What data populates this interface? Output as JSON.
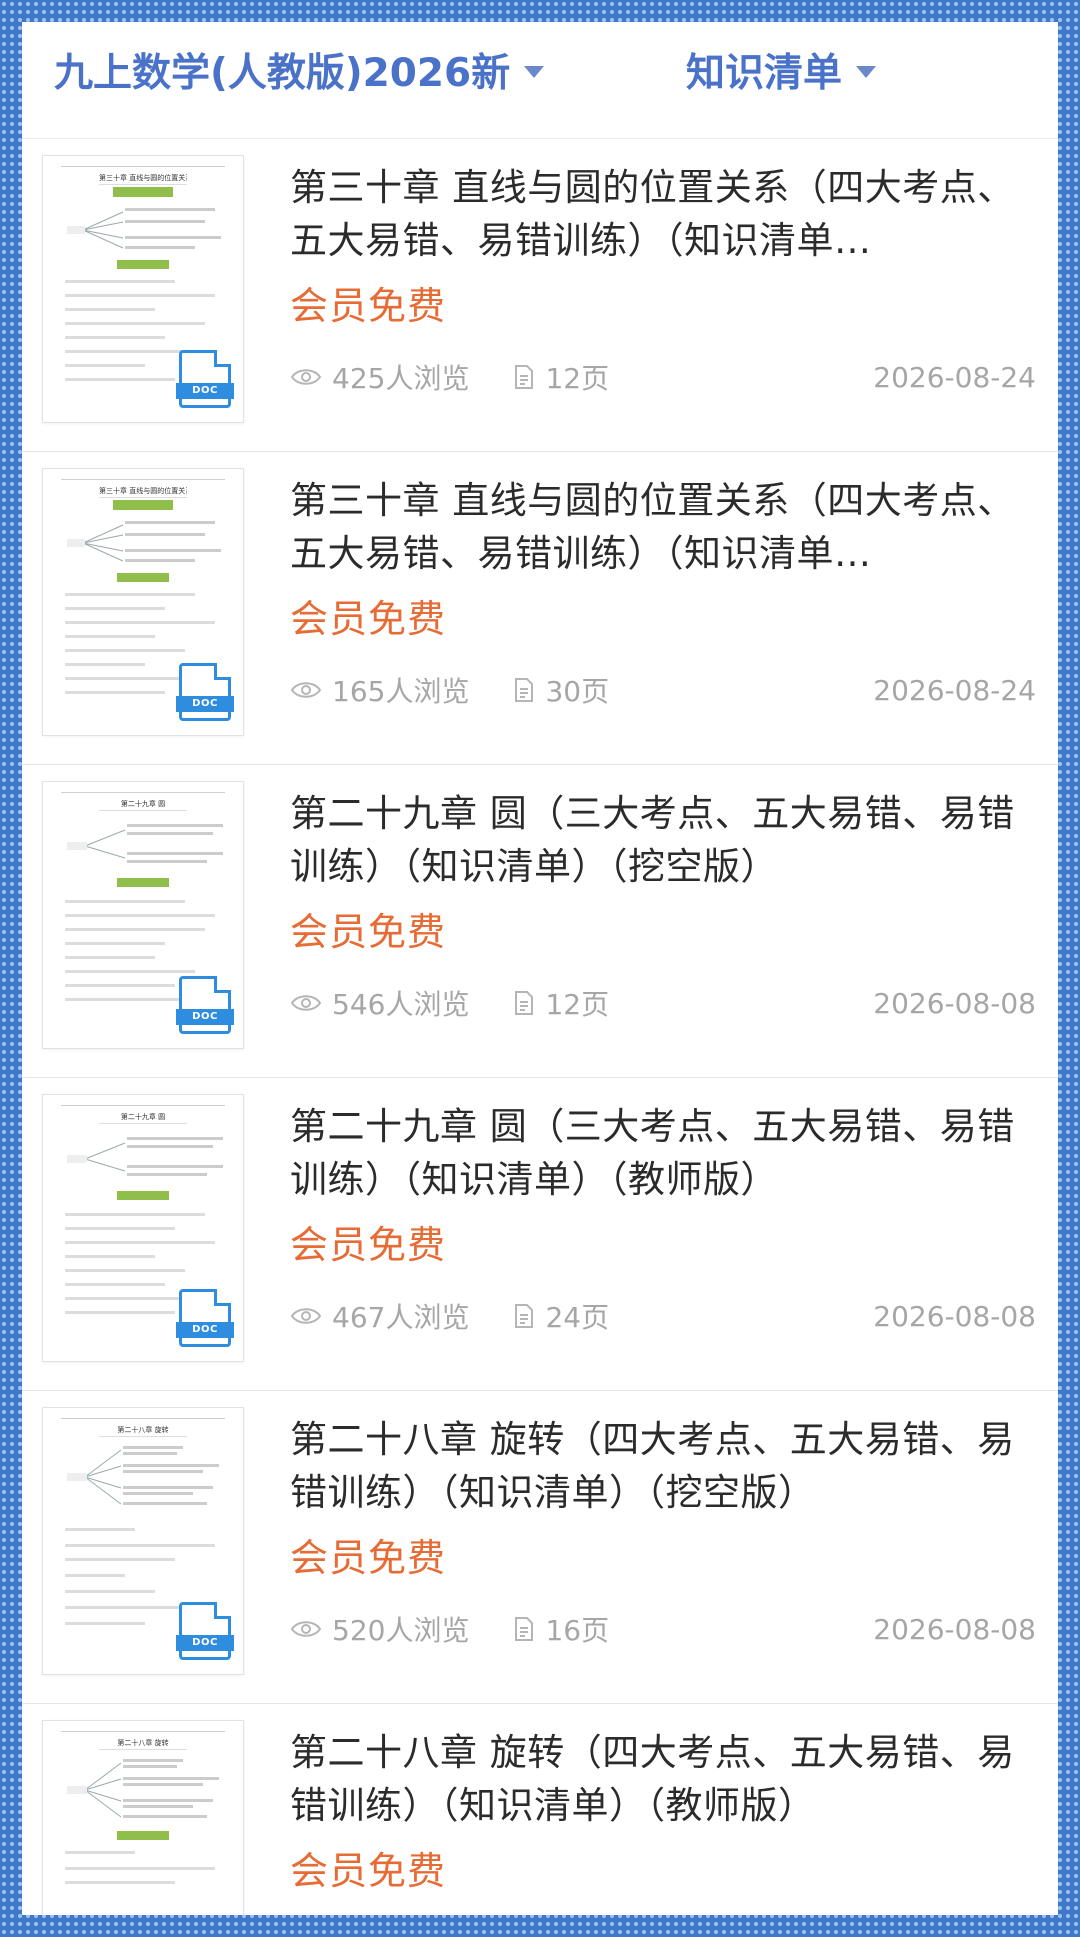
{
  "header": {
    "subject_label": "九上数学(人教版)2026新",
    "category_label": "知识清单"
  },
  "items": [
    {
      "title": "第三十章 直线与圆的位置关系（四大考点、五大易错、易错训练）（知识清单…",
      "price": "会员免费",
      "views": "425人浏览",
      "pages": "12页",
      "date": "2026-08-24",
      "thumb_chapter": "第三十章  直线与圆的位置关系",
      "doc_badge": "DOC"
    },
    {
      "title": "第三十章 直线与圆的位置关系（四大考点、五大易错、易错训练）（知识清单…",
      "price": "会员免费",
      "views": "165人浏览",
      "pages": "30页",
      "date": "2026-08-24",
      "thumb_chapter": "第三十章  直线与圆的位置关系",
      "doc_badge": "DOC"
    },
    {
      "title": "第二十九章 圆（三大考点、五大易错、易错训练）（知识清单）（挖空版）",
      "price": "会员免费",
      "views": "546人浏览",
      "pages": "12页",
      "date": "2026-08-08",
      "thumb_chapter": "第二十九章  圆",
      "doc_badge": "DOC"
    },
    {
      "title": "第二十九章 圆（三大考点、五大易错、易错训练）（知识清单）（教师版）",
      "price": "会员免费",
      "views": "467人浏览",
      "pages": "24页",
      "date": "2026-08-08",
      "thumb_chapter": "第二十九章  圆",
      "doc_badge": "DOC"
    },
    {
      "title": "第二十八章 旋转（四大考点、五大易错、易错训练）（知识清单）（挖空版）",
      "price": "会员免费",
      "views": "520人浏览",
      "pages": "16页",
      "date": "2026-08-08",
      "thumb_chapter": "第二十八章  旋转",
      "doc_badge": "DOC"
    },
    {
      "title": "第二十八章 旋转（四大考点、五大易错、易错训练）（知识清单）（教师版）",
      "price": "会员免费",
      "views": "",
      "pages": "",
      "date": "",
      "thumb_chapter": "第二十八章  旋转",
      "doc_badge": ""
    }
  ],
  "colors": {
    "accent_blue": "#4a72c9",
    "price_orange": "#e76b34",
    "doc_blue": "#2f8de0",
    "meta_gray": "#a6a6a6"
  },
  "icons": {
    "views": "eye-icon",
    "pages": "document-page-icon",
    "dropdown": "caret-down-icon",
    "file": "doc-file-icon"
  }
}
